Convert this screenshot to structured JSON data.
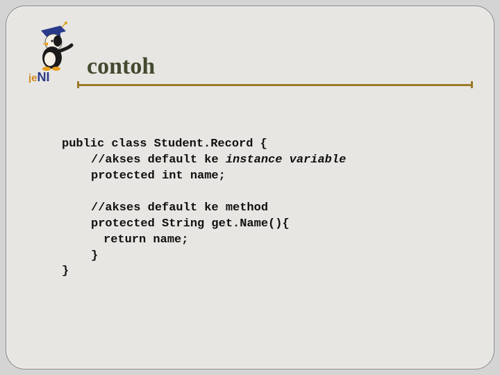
{
  "slide": {
    "title": "contoh",
    "logo_text": "jeNI",
    "code": {
      "l1": "public class Student.Record {",
      "l2_a": "//akses default ke ",
      "l2_b": "instance variable",
      "l3": "protected int name;",
      "l4": "//akses default ke method",
      "l5": "protected String get.Name(){",
      "l6": "return name;",
      "l7": "}",
      "l8": "}"
    }
  }
}
